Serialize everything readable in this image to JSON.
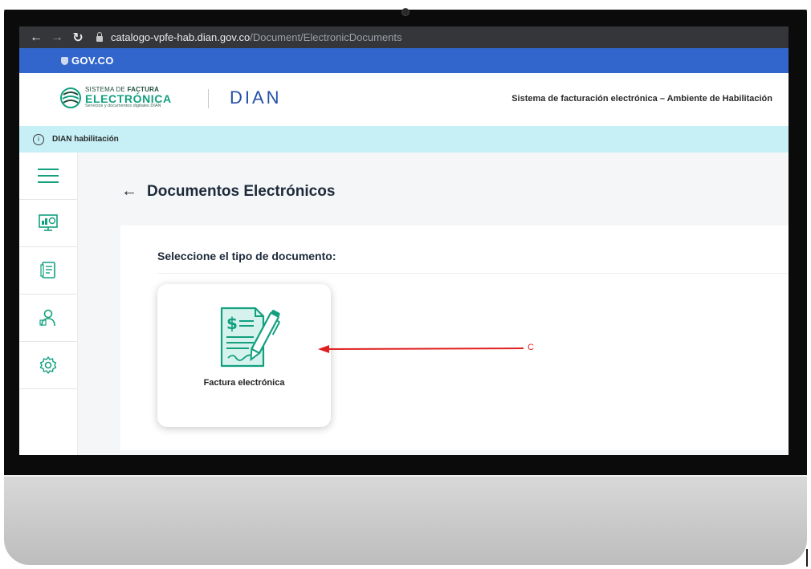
{
  "browser": {
    "back_icon": "arrow-left-icon",
    "forward_icon": "arrow-right-icon",
    "reload_icon": "reload-icon",
    "url_host": "catalogo-vpfe-hab.dian.gov.co",
    "url_path": "/Document/ElectronicDocuments"
  },
  "govco": {
    "label": "GOV.CO"
  },
  "header": {
    "sfe_line1_a": "SISTEMA DE ",
    "sfe_line1_b": "FACTURA",
    "sfe_line2": "ELECTRÓNICA",
    "sfe_line3": "Servicios y documentos digitales DIAN",
    "dian_logo": "DIAN",
    "title": "Sistema de facturación electrónica – Ambiente de Habilitación"
  },
  "info_bar": {
    "text": "DIAN habilitación"
  },
  "sidebar": {
    "items": [
      {
        "icon": "menu-icon"
      },
      {
        "icon": "dashboard-icon"
      },
      {
        "icon": "documents-icon"
      },
      {
        "icon": "users-icon"
      },
      {
        "icon": "settings-icon"
      }
    ]
  },
  "main": {
    "page_title": "Documentos Electrónicos",
    "section_title": "Seleccione el tipo de documento:",
    "documents": [
      {
        "label": "Factura electrónica",
        "icon": "invoice-icon"
      }
    ]
  },
  "annotation": {
    "letter": "C",
    "color": "#e02020"
  },
  "colors": {
    "govco_blue": "#3366cc",
    "info_bar": "#c6f0f6",
    "accent_green": "#12a07f",
    "dian_blue": "#2451a8"
  }
}
